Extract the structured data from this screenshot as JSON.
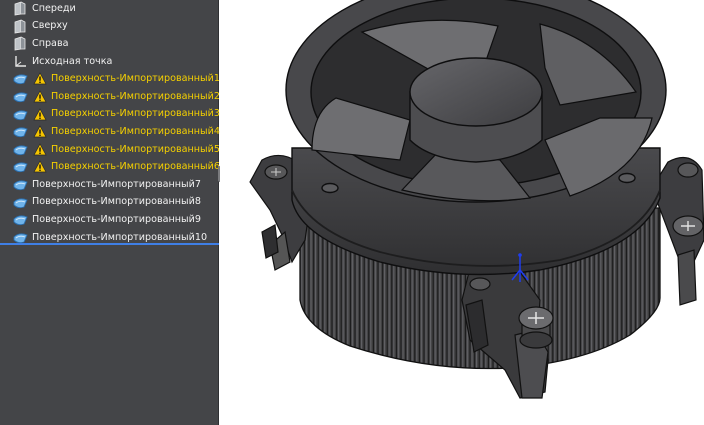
{
  "feature_tree": {
    "items": [
      {
        "type": "plane",
        "label": "Спереди",
        "warning": false,
        "icon": "plane-icon"
      },
      {
        "type": "plane",
        "label": "Сверху",
        "warning": false,
        "icon": "plane-icon"
      },
      {
        "type": "plane",
        "label": "Справа",
        "warning": false,
        "icon": "plane-icon"
      },
      {
        "type": "origin",
        "label": "Исходная точка",
        "warning": false,
        "icon": "origin-icon"
      },
      {
        "type": "surface",
        "label": "Поверхность-Импортированный1",
        "warning": true,
        "icon": "surface-icon"
      },
      {
        "type": "surface",
        "label": "Поверхность-Импортированный2",
        "warning": true,
        "icon": "surface-icon"
      },
      {
        "type": "surface",
        "label": "Поверхность-Импортированный3",
        "warning": true,
        "icon": "surface-icon"
      },
      {
        "type": "surface",
        "label": "Поверхность-Импортированный4",
        "warning": true,
        "icon": "surface-icon"
      },
      {
        "type": "surface",
        "label": "Поверхность-Импортированный5",
        "warning": true,
        "icon": "surface-icon"
      },
      {
        "type": "surface",
        "label": "Поверхность-Импортированный6",
        "warning": true,
        "icon": "surface-icon"
      },
      {
        "type": "surface",
        "label": "Поверхность-Импортированный7",
        "warning": false,
        "icon": "surface-icon"
      },
      {
        "type": "surface",
        "label": "Поверхность-Импортированный8",
        "warning": false,
        "icon": "surface-icon"
      },
      {
        "type": "surface",
        "label": "Поверхность-Импортированный9",
        "warning": false,
        "icon": "surface-icon"
      },
      {
        "type": "surface",
        "label": "Поверхность-Импортированный10",
        "warning": false,
        "icon": "surface-icon"
      }
    ]
  },
  "colors": {
    "panel_background": "#444548",
    "label_text": "#f2f2f2",
    "warning_text": "#f5d000",
    "rollback_bar": "#3f7fe6",
    "model_body": "#3a3a3c",
    "viewport_background": "#ffffff"
  },
  "viewport": {
    "model": "cpu-cooler-model",
    "triad": "origin-triad-icon"
  }
}
